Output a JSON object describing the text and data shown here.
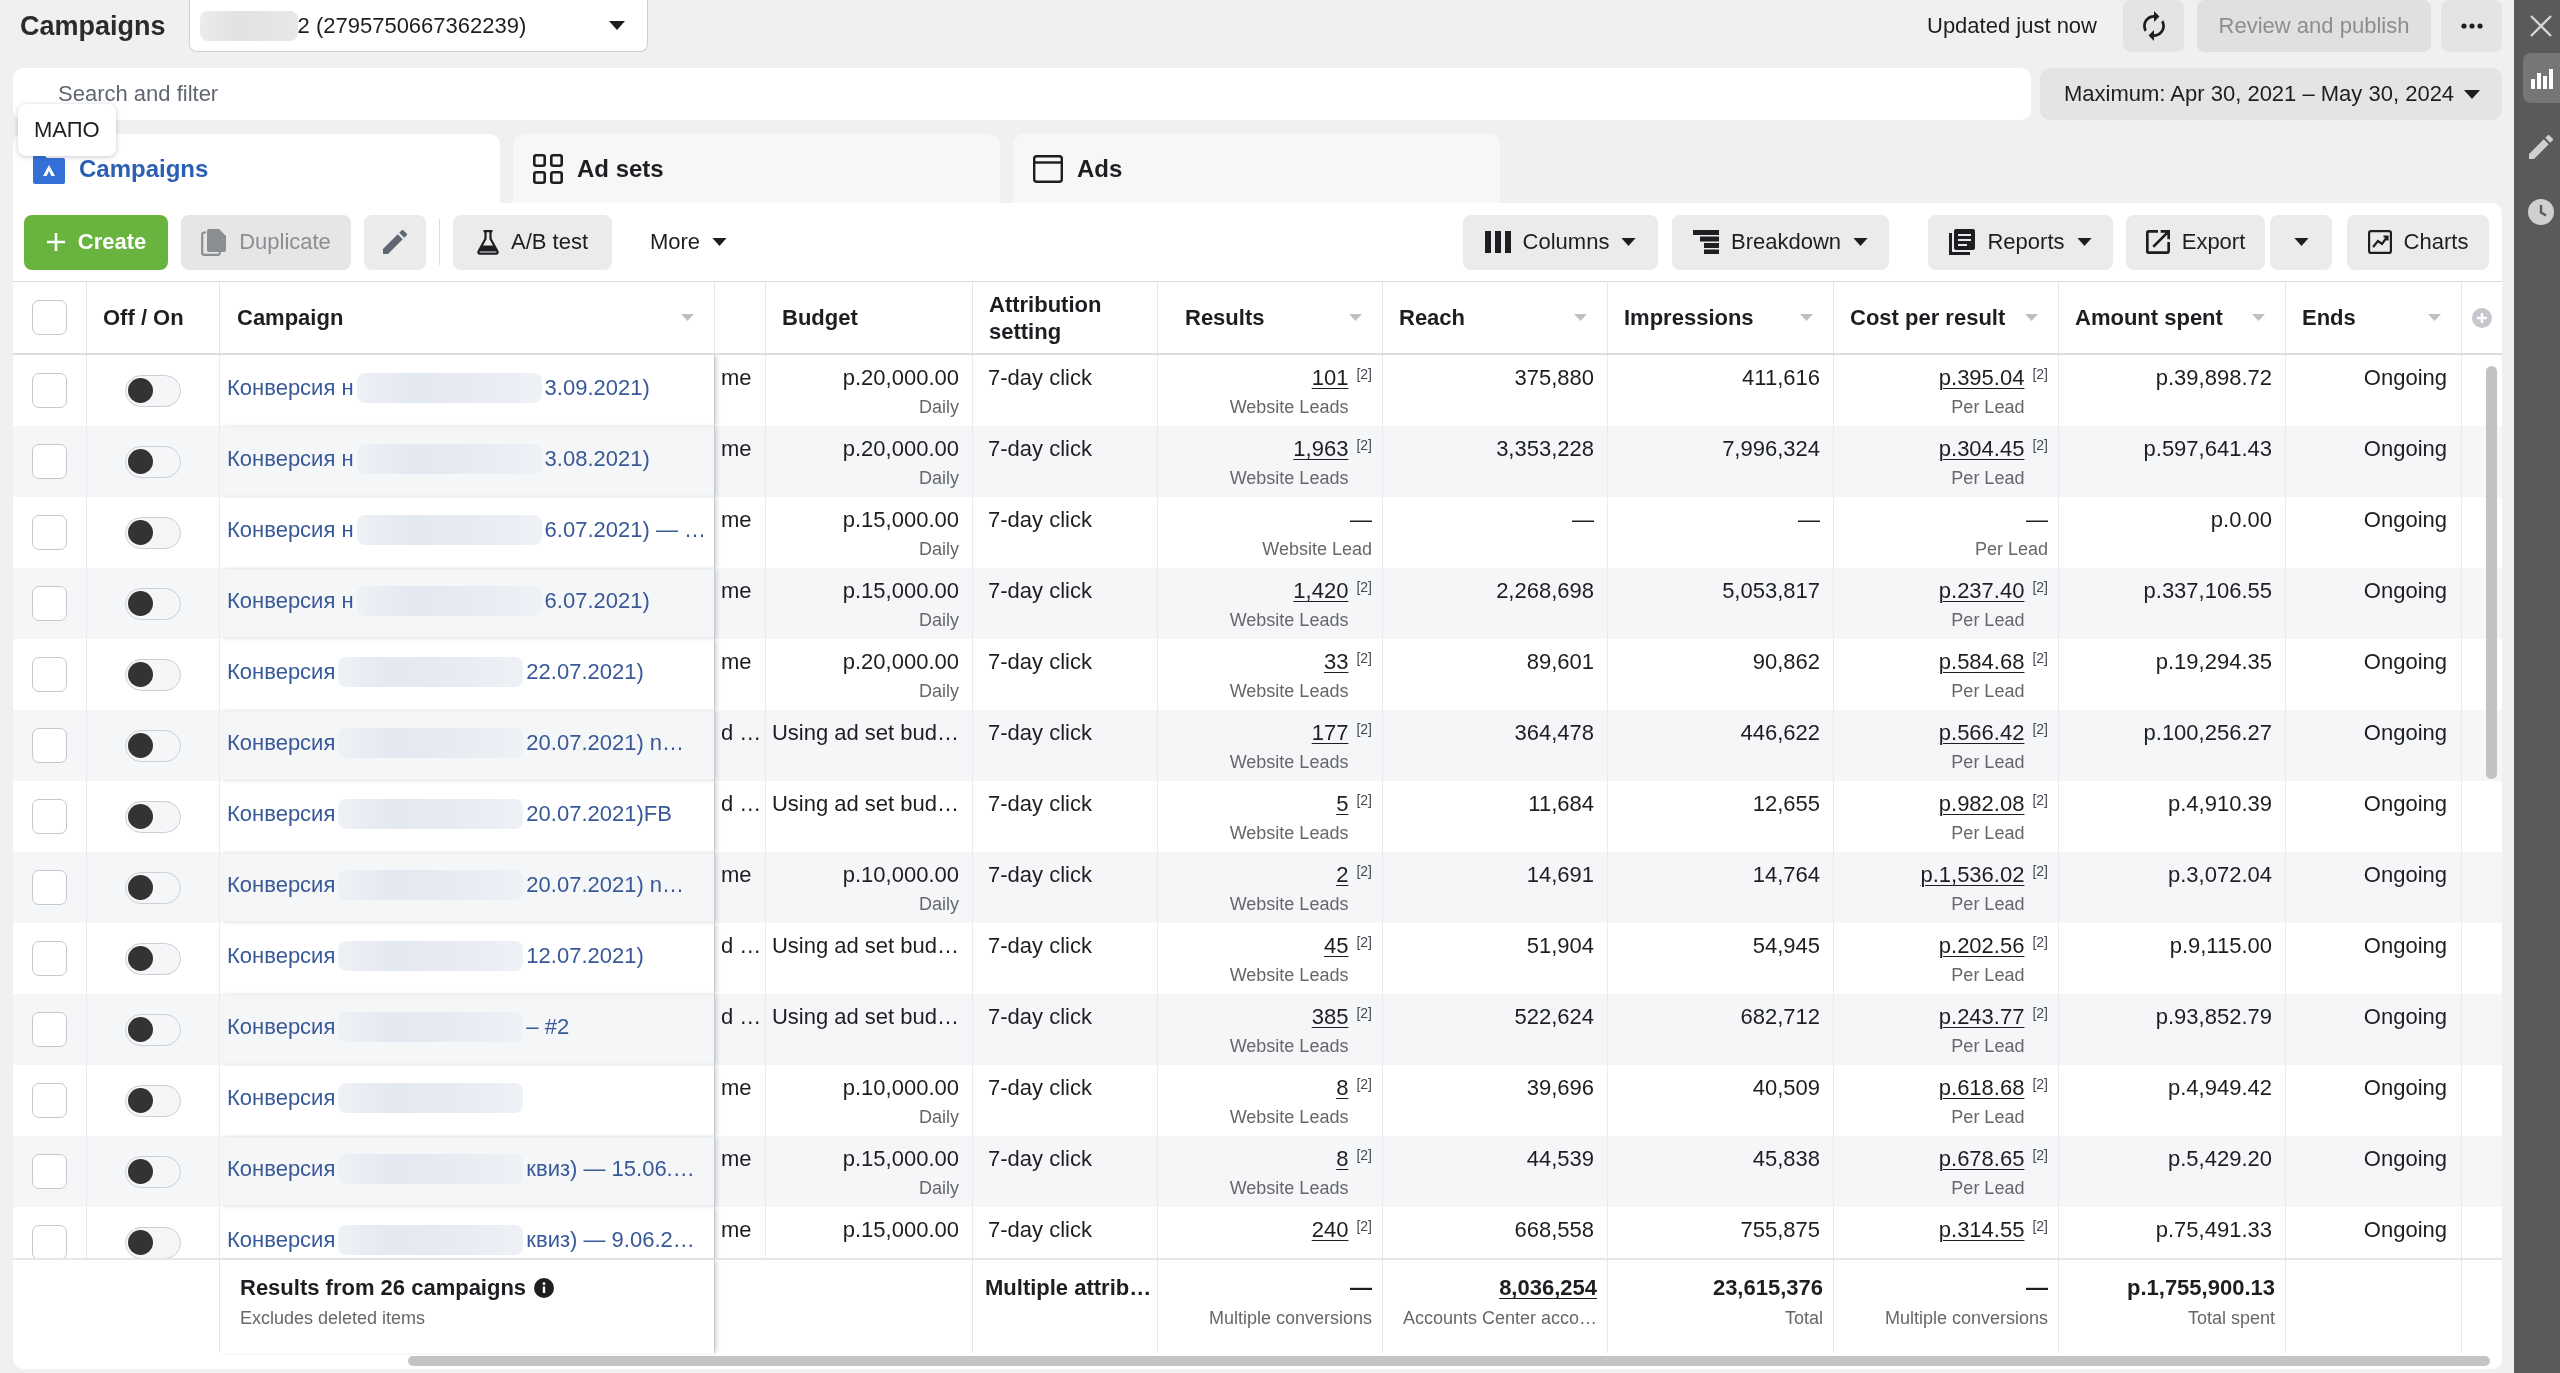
{
  "topbar": {
    "title": "Campaigns",
    "account": {
      "label": "2 (2795750667362239)",
      "redacted": true
    },
    "status": "Updated just now",
    "review_button": {
      "label": "Review and publish",
      "disabled": true
    }
  },
  "search": {
    "placeholder": "Search and filter"
  },
  "date_range": {
    "label": "Maximum: Apr 30, 2021 – May 30, 2024"
  },
  "tooltip": {
    "text": "МАПО"
  },
  "tabs": [
    {
      "kind": "campaigns",
      "label": "Campaigns",
      "selected": true
    },
    {
      "kind": "ad_sets",
      "label": "Ad sets",
      "selected": false
    },
    {
      "kind": "ads",
      "label": "Ads",
      "selected": false
    }
  ],
  "toolbar": {
    "left": [
      {
        "kind": "create",
        "label": "Create",
        "disabled": false
      },
      {
        "kind": "duplicate",
        "label": "Duplicate",
        "disabled": true
      },
      {
        "kind": "edit",
        "disabled": false
      },
      {
        "kind": "ab_test",
        "label": "A/B test",
        "disabled": false
      },
      {
        "kind": "more",
        "label": "More",
        "disabled": false
      }
    ],
    "right": [
      {
        "kind": "columns",
        "label": "Columns"
      },
      {
        "kind": "breakdown",
        "label": "Breakdown"
      },
      {
        "kind": "reports",
        "label": "Reports"
      },
      {
        "kind": "export",
        "label": "Export"
      },
      {
        "kind": "export_menu"
      },
      {
        "kind": "charts",
        "label": "Charts"
      }
    ]
  },
  "table": {
    "columns": [
      {
        "kind": "checkbox",
        "checked": false
      },
      {
        "kind": "text",
        "label": "Off / On",
        "dropdown": false
      },
      {
        "kind": "text",
        "label": "Campaign",
        "dropdown": true
      },
      {
        "kind": "blank"
      },
      {
        "kind": "text",
        "label": "Budget",
        "dropdown": false
      },
      {
        "kind": "text",
        "label": "Attribution setting",
        "dropdown": false
      },
      {
        "kind": "text",
        "label": "Results",
        "dropdown": true
      },
      {
        "kind": "text",
        "label": "Reach",
        "dropdown": true
      },
      {
        "kind": "text",
        "label": "Impressions",
        "dropdown": true
      },
      {
        "kind": "text",
        "label": "Cost per result",
        "dropdown": true
      },
      {
        "kind": "text",
        "label": "Amount spent",
        "dropdown": true
      },
      {
        "kind": "text",
        "label": "Ends",
        "dropdown": true
      },
      {
        "kind": "add"
      }
    ],
    "rows": [
      {
        "checked": false,
        "on": false,
        "campaign": {
          "start": "Конверсия н",
          "end": "3.09.2021)",
          "redacted": true
        },
        "column_4": "me",
        "budget": {
          "value": "p.20,000.00",
          "label": "Daily"
        },
        "attribution": "7-day click",
        "results": {
          "value": "101",
          "note": "[2]",
          "label": "Website Leads"
        },
        "reach": "375,880",
        "impressions": "411,616",
        "cost_per_result": {
          "value": "p.395.04",
          "note": "[2]",
          "label": "Per Lead"
        },
        "amount_spent": "p.39,898.72",
        "ends": "Ongoing"
      },
      {
        "checked": false,
        "on": false,
        "campaign": {
          "start": "Конверсия н",
          "end": "3.08.2021)",
          "redacted": true
        },
        "column_4": "me",
        "budget": {
          "value": "p.20,000.00",
          "label": "Daily"
        },
        "attribution": "7-day click",
        "results": {
          "value": "1,963",
          "note": "[2]",
          "label": "Website Leads"
        },
        "reach": "3,353,228",
        "impressions": "7,996,324",
        "cost_per_result": {
          "value": "p.304.45",
          "note": "[2]",
          "label": "Per Lead"
        },
        "amount_spent": "p.597,641.43",
        "ends": "Ongoing"
      },
      {
        "checked": false,
        "on": false,
        "campaign": {
          "start": "Конверсия н",
          "end": "6.07.2021) — …",
          "redacted": true
        },
        "column_4": "me",
        "budget": {
          "value": "p.15,000.00",
          "label": "Daily"
        },
        "attribution": "7-day click",
        "results": {
          "value": "—",
          "label": "Website Lead"
        },
        "reach": "—",
        "impressions": "—",
        "cost_per_result": {
          "value": "—",
          "label": "Per Lead"
        },
        "amount_spent": "p.0.00",
        "ends": "Ongoing"
      },
      {
        "checked": false,
        "on": false,
        "campaign": {
          "start": "Конверсия н",
          "end": "6.07.2021)",
          "redacted": true
        },
        "column_4": "me",
        "budget": {
          "value": "p.15,000.00",
          "label": "Daily"
        },
        "attribution": "7-day click",
        "results": {
          "value": "1,420",
          "note": "[2]",
          "label": "Website Leads"
        },
        "reach": "2,268,698",
        "impressions": "5,053,817",
        "cost_per_result": {
          "value": "p.237.40",
          "note": "[2]",
          "label": "Per Lead"
        },
        "amount_spent": "p.337,106.55",
        "ends": "Ongoing"
      },
      {
        "checked": false,
        "on": false,
        "campaign": {
          "start": "Конверсия",
          "end": "22.07.2021)",
          "redacted": true
        },
        "column_4": "me",
        "budget": {
          "value": "p.20,000.00",
          "label": "Daily"
        },
        "attribution": "7-day click",
        "results": {
          "value": "33",
          "note": "[2]",
          "label": "Website Leads"
        },
        "reach": "89,601",
        "impressions": "90,862",
        "cost_per_result": {
          "value": "p.584.68",
          "note": "[2]",
          "label": "Per Lead"
        },
        "amount_spent": "p.19,294.35",
        "ends": "Ongoing"
      },
      {
        "checked": false,
        "on": false,
        "campaign": {
          "start": "Конверсия",
          "end": "20.07.2021) n…",
          "redacted": true
        },
        "column_4": "d …",
        "budget": {
          "value": "Using ad set bud…"
        },
        "attribution": "7-day click",
        "results": {
          "value": "177",
          "note": "[2]",
          "label": "Website Leads"
        },
        "reach": "364,478",
        "impressions": "446,622",
        "cost_per_result": {
          "value": "p.566.42",
          "note": "[2]",
          "label": "Per Lead"
        },
        "amount_spent": "p.100,256.27",
        "ends": "Ongoing"
      },
      {
        "checked": false,
        "on": false,
        "campaign": {
          "start": "Конверсия",
          "end": "20.07.2021)FB",
          "redacted": true
        },
        "column_4": "d …",
        "budget": {
          "value": "Using ad set bud…"
        },
        "attribution": "7-day click",
        "results": {
          "value": "5",
          "note": "[2]",
          "label": "Website Leads"
        },
        "reach": "11,684",
        "impressions": "12,655",
        "cost_per_result": {
          "value": "p.982.08",
          "note": "[2]",
          "label": "Per Lead"
        },
        "amount_spent": "p.4,910.39",
        "ends": "Ongoing"
      },
      {
        "checked": false,
        "on": false,
        "campaign": {
          "start": "Конверсия",
          "end": "20.07.2021) n…",
          "redacted": true
        },
        "column_4": "me",
        "budget": {
          "value": "p.10,000.00",
          "label": "Daily"
        },
        "attribution": "7-day click",
        "results": {
          "value": "2",
          "note": "[2]",
          "label": "Website Leads"
        },
        "reach": "14,691",
        "impressions": "14,764",
        "cost_per_result": {
          "value": "p.1,536.02",
          "note": "[2]",
          "label": "Per Lead"
        },
        "amount_spent": "p.3,072.04",
        "ends": "Ongoing"
      },
      {
        "checked": false,
        "on": false,
        "campaign": {
          "start": "Конверсия",
          "end": "12.07.2021)",
          "redacted": true
        },
        "column_4": "d …",
        "budget": {
          "value": "Using ad set bud…"
        },
        "attribution": "7-day click",
        "results": {
          "value": "45",
          "note": "[2]",
          "label": "Website Leads"
        },
        "reach": "51,904",
        "impressions": "54,945",
        "cost_per_result": {
          "value": "p.202.56",
          "note": "[2]",
          "label": "Per Lead"
        },
        "amount_spent": "p.9,115.00",
        "ends": "Ongoing"
      },
      {
        "checked": false,
        "on": false,
        "campaign": {
          "start": "Конверсия",
          "end": "– #2",
          "redacted": true
        },
        "column_4": "d …",
        "budget": {
          "value": "Using ad set bud…"
        },
        "attribution": "7-day click",
        "results": {
          "value": "385",
          "note": "[2]",
          "label": "Website Leads"
        },
        "reach": "522,624",
        "impressions": "682,712",
        "cost_per_result": {
          "value": "p.243.77",
          "note": "[2]",
          "label": "Per Lead"
        },
        "amount_spent": "p.93,852.79",
        "ends": "Ongoing"
      },
      {
        "checked": false,
        "on": false,
        "campaign": {
          "start": "Конверсия",
          "redacted": true
        },
        "column_4": "me",
        "budget": {
          "value": "p.10,000.00",
          "label": "Daily"
        },
        "attribution": "7-day click",
        "results": {
          "value": "8",
          "note": "[2]",
          "label": "Website Leads"
        },
        "reach": "39,696",
        "impressions": "40,509",
        "cost_per_result": {
          "value": "p.618.68",
          "note": "[2]",
          "label": "Per Lead"
        },
        "amount_spent": "p.4,949.42",
        "ends": "Ongoing"
      },
      {
        "checked": false,
        "on": false,
        "campaign": {
          "start": "Конверсия",
          "end": "квиз) — 15.06.…",
          "redacted": true
        },
        "column_4": "me",
        "budget": {
          "value": "p.15,000.00",
          "label": "Daily"
        },
        "attribution": "7-day click",
        "results": {
          "value": "8",
          "note": "[2]",
          "label": "Website Leads"
        },
        "reach": "44,539",
        "impressions": "45,838",
        "cost_per_result": {
          "value": "p.678.65",
          "note": "[2]",
          "label": "Per Lead"
        },
        "amount_spent": "p.5,429.20",
        "ends": "Ongoing"
      },
      {
        "checked": false,
        "on": false,
        "campaign": {
          "start": "Конверсия",
          "end": "квиз) — 9.06.2…",
          "redacted": true
        },
        "column_4": "me",
        "budget": {
          "value": "p.15,000.00"
        },
        "attribution": "7-day click",
        "results": {
          "value": "240",
          "note": "[2]"
        },
        "reach": "668,558",
        "impressions": "755,875",
        "cost_per_result": {
          "value": "p.314.55",
          "note": "[2]"
        },
        "amount_spent": "p.75,491.33",
        "ends": "Ongoing"
      }
    ],
    "footer": {
      "campaign": {
        "title": "Results from 26 campaigns",
        "subtitle": "Excludes deleted items"
      },
      "attribution": "Multiple attrib…",
      "results": {
        "value": "—",
        "label": "Multiple conversions"
      },
      "reach": {
        "value": "8,036,254",
        "label": "Accounts Center acco…"
      },
      "impressions": {
        "value": "23,615,376",
        "label": "Total"
      },
      "cost_per_result": {
        "value": "—",
        "label": "Multiple conversions"
      },
      "amount_spent": {
        "value": "p.1,755,900.13",
        "label": "Total spent"
      }
    }
  }
}
